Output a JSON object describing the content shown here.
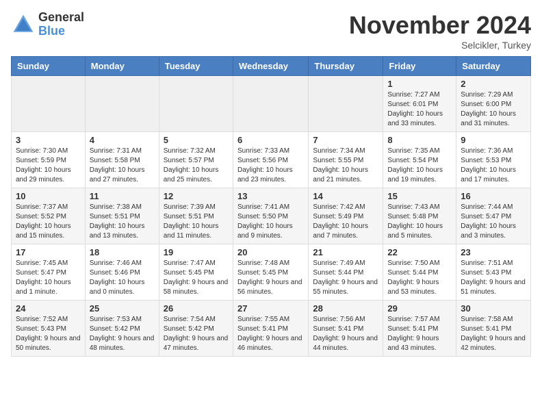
{
  "logo": {
    "general": "General",
    "blue": "Blue"
  },
  "title": "November 2024",
  "location": "Selcikler, Turkey",
  "days_of_week": [
    "Sunday",
    "Monday",
    "Tuesday",
    "Wednesday",
    "Thursday",
    "Friday",
    "Saturday"
  ],
  "weeks": [
    [
      {
        "day": "",
        "info": ""
      },
      {
        "day": "",
        "info": ""
      },
      {
        "day": "",
        "info": ""
      },
      {
        "day": "",
        "info": ""
      },
      {
        "day": "",
        "info": ""
      },
      {
        "day": "1",
        "info": "Sunrise: 7:27 AM\nSunset: 6:01 PM\nDaylight: 10 hours and 33 minutes."
      },
      {
        "day": "2",
        "info": "Sunrise: 7:29 AM\nSunset: 6:00 PM\nDaylight: 10 hours and 31 minutes."
      }
    ],
    [
      {
        "day": "3",
        "info": "Sunrise: 7:30 AM\nSunset: 5:59 PM\nDaylight: 10 hours and 29 minutes."
      },
      {
        "day": "4",
        "info": "Sunrise: 7:31 AM\nSunset: 5:58 PM\nDaylight: 10 hours and 27 minutes."
      },
      {
        "day": "5",
        "info": "Sunrise: 7:32 AM\nSunset: 5:57 PM\nDaylight: 10 hours and 25 minutes."
      },
      {
        "day": "6",
        "info": "Sunrise: 7:33 AM\nSunset: 5:56 PM\nDaylight: 10 hours and 23 minutes."
      },
      {
        "day": "7",
        "info": "Sunrise: 7:34 AM\nSunset: 5:55 PM\nDaylight: 10 hours and 21 minutes."
      },
      {
        "day": "8",
        "info": "Sunrise: 7:35 AM\nSunset: 5:54 PM\nDaylight: 10 hours and 19 minutes."
      },
      {
        "day": "9",
        "info": "Sunrise: 7:36 AM\nSunset: 5:53 PM\nDaylight: 10 hours and 17 minutes."
      }
    ],
    [
      {
        "day": "10",
        "info": "Sunrise: 7:37 AM\nSunset: 5:52 PM\nDaylight: 10 hours and 15 minutes."
      },
      {
        "day": "11",
        "info": "Sunrise: 7:38 AM\nSunset: 5:51 PM\nDaylight: 10 hours and 13 minutes."
      },
      {
        "day": "12",
        "info": "Sunrise: 7:39 AM\nSunset: 5:51 PM\nDaylight: 10 hours and 11 minutes."
      },
      {
        "day": "13",
        "info": "Sunrise: 7:41 AM\nSunset: 5:50 PM\nDaylight: 10 hours and 9 minutes."
      },
      {
        "day": "14",
        "info": "Sunrise: 7:42 AM\nSunset: 5:49 PM\nDaylight: 10 hours and 7 minutes."
      },
      {
        "day": "15",
        "info": "Sunrise: 7:43 AM\nSunset: 5:48 PM\nDaylight: 10 hours and 5 minutes."
      },
      {
        "day": "16",
        "info": "Sunrise: 7:44 AM\nSunset: 5:47 PM\nDaylight: 10 hours and 3 minutes."
      }
    ],
    [
      {
        "day": "17",
        "info": "Sunrise: 7:45 AM\nSunset: 5:47 PM\nDaylight: 10 hours and 1 minute."
      },
      {
        "day": "18",
        "info": "Sunrise: 7:46 AM\nSunset: 5:46 PM\nDaylight: 10 hours and 0 minutes."
      },
      {
        "day": "19",
        "info": "Sunrise: 7:47 AM\nSunset: 5:45 PM\nDaylight: 9 hours and 58 minutes."
      },
      {
        "day": "20",
        "info": "Sunrise: 7:48 AM\nSunset: 5:45 PM\nDaylight: 9 hours and 56 minutes."
      },
      {
        "day": "21",
        "info": "Sunrise: 7:49 AM\nSunset: 5:44 PM\nDaylight: 9 hours and 55 minutes."
      },
      {
        "day": "22",
        "info": "Sunrise: 7:50 AM\nSunset: 5:44 PM\nDaylight: 9 hours and 53 minutes."
      },
      {
        "day": "23",
        "info": "Sunrise: 7:51 AM\nSunset: 5:43 PM\nDaylight: 9 hours and 51 minutes."
      }
    ],
    [
      {
        "day": "24",
        "info": "Sunrise: 7:52 AM\nSunset: 5:43 PM\nDaylight: 9 hours and 50 minutes."
      },
      {
        "day": "25",
        "info": "Sunrise: 7:53 AM\nSunset: 5:42 PM\nDaylight: 9 hours and 48 minutes."
      },
      {
        "day": "26",
        "info": "Sunrise: 7:54 AM\nSunset: 5:42 PM\nDaylight: 9 hours and 47 minutes."
      },
      {
        "day": "27",
        "info": "Sunrise: 7:55 AM\nSunset: 5:41 PM\nDaylight: 9 hours and 46 minutes."
      },
      {
        "day": "28",
        "info": "Sunrise: 7:56 AM\nSunset: 5:41 PM\nDaylight: 9 hours and 44 minutes."
      },
      {
        "day": "29",
        "info": "Sunrise: 7:57 AM\nSunset: 5:41 PM\nDaylight: 9 hours and 43 minutes."
      },
      {
        "day": "30",
        "info": "Sunrise: 7:58 AM\nSunset: 5:41 PM\nDaylight: 9 hours and 42 minutes."
      }
    ]
  ]
}
